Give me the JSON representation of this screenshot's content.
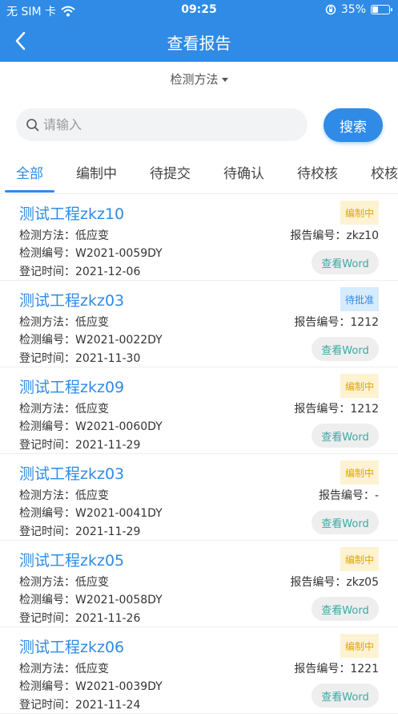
{
  "status_bar": {
    "carrier": "无 SIM 卡",
    "time": "09:25",
    "battery": "35%",
    "battery_level": 0.35
  },
  "nav": {
    "title": "查看报告"
  },
  "filter": {
    "label": "检测方法"
  },
  "search": {
    "placeholder": "请输入",
    "button_label": "搜索"
  },
  "tabs": [
    {
      "label": "全部"
    },
    {
      "label": "编制中"
    },
    {
      "label": "待提交"
    },
    {
      "label": "待确认"
    },
    {
      "label": "待校核"
    },
    {
      "label": "校核"
    }
  ],
  "labels": {
    "method": "检测方法：",
    "code": "检测编号：",
    "time": "登记时间：",
    "report_no": "报告编号：",
    "word_button": "查看Word"
  },
  "colors": {
    "primary": "#2f8be6",
    "badge_yellow_bg": "#fdf3d3",
    "badge_yellow_text": "#e0a800",
    "badge_blue_bg": "#d6ebfb",
    "badge_blue_text": "#2f8be6",
    "word_text": "#3aa9a3"
  },
  "reports": [
    {
      "title": "测试工程zkz10",
      "method": "低应变",
      "code": "W2021-0059DY",
      "time": "2021-12-06",
      "report_no": "zkz10",
      "status": "编制中",
      "status_type": "yellow"
    },
    {
      "title": "测试工程zkz03",
      "method": "低应变",
      "code": "W2021-0022DY",
      "time": "2021-11-30",
      "report_no": "1212",
      "status": "待批准",
      "status_type": "blue"
    },
    {
      "title": "测试工程zkz09",
      "method": "低应变",
      "code": "W2021-0060DY",
      "time": "2021-11-29",
      "report_no": "1212",
      "status": "编制中",
      "status_type": "yellow"
    },
    {
      "title": "测试工程zkz03",
      "method": "低应变",
      "code": "W2021-0041DY",
      "time": "2021-11-29",
      "report_no": "-",
      "status": "编制中",
      "status_type": "yellow"
    },
    {
      "title": "测试工程zkz05",
      "method": "低应变",
      "code": "W2021-0058DY",
      "time": "2021-11-26",
      "report_no": "zkz05",
      "status": "编制中",
      "status_type": "yellow"
    },
    {
      "title": "测试工程zkz06",
      "method": "低应变",
      "code": "W2021-0039DY",
      "time": "2021-11-24",
      "report_no": "1221",
      "status": "编制中",
      "status_type": "yellow"
    }
  ]
}
